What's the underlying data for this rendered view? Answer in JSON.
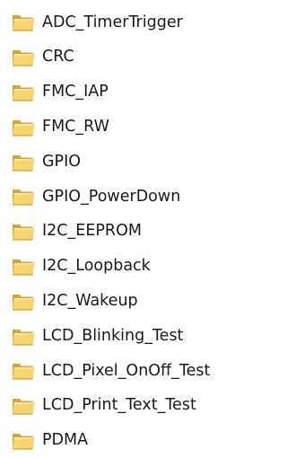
{
  "folders": [
    {
      "name": "ADC_TimerTrigger",
      "icon": "folder-icon"
    },
    {
      "name": "CRC",
      "icon": "folder-icon"
    },
    {
      "name": "FMC_IAP",
      "icon": "folder-icon"
    },
    {
      "name": "FMC_RW",
      "icon": "folder-icon"
    },
    {
      "name": "GPIO",
      "icon": "folder-icon"
    },
    {
      "name": "GPIO_PowerDown",
      "icon": "folder-icon"
    },
    {
      "name": "I2C_EEPROM",
      "icon": "folder-icon"
    },
    {
      "name": "I2C_Loopback",
      "icon": "folder-icon"
    },
    {
      "name": "I2C_Wakeup",
      "icon": "folder-icon"
    },
    {
      "name": "LCD_Blinking_Test",
      "icon": "folder-icon"
    },
    {
      "name": "LCD_Pixel_OnOff_Test",
      "icon": "folder-icon"
    },
    {
      "name": "LCD_Print_Text_Test",
      "icon": "folder-icon"
    },
    {
      "name": "PDMA",
      "icon": "folder-icon"
    }
  ],
  "colors": {
    "folder_back": "#d9a431",
    "folder_front": "#f7d56e",
    "folder_paper": "#fbfbf3",
    "text": "#1a1a1a"
  }
}
